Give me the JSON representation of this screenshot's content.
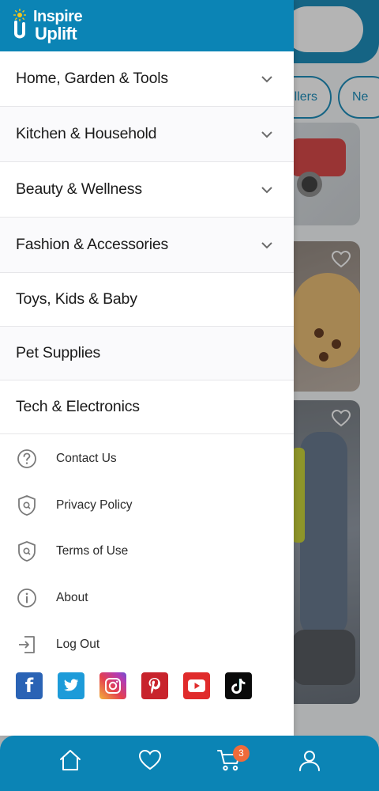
{
  "app": {
    "brand_line1": "Inspire",
    "brand_line2": "Uplift",
    "brand_color": "#0b84b5"
  },
  "background": {
    "chips": [
      "Best Sellers",
      "New"
    ],
    "chip_visible": [
      "llers",
      "Ne"
    ]
  },
  "drawer": {
    "categories": [
      {
        "label": "Home, Garden & Tools",
        "expandable": true
      },
      {
        "label": "Kitchen & Household",
        "expandable": true
      },
      {
        "label": "Beauty & Wellness",
        "expandable": true
      },
      {
        "label": "Fashion & Accessories",
        "expandable": true
      },
      {
        "label": "Toys, Kids & Baby",
        "expandable": false
      },
      {
        "label": "Pet Supplies",
        "expandable": false
      },
      {
        "label": "Tech & Electronics",
        "expandable": false
      }
    ],
    "utility": [
      {
        "label": "Contact Us",
        "icon": "question-circle-icon"
      },
      {
        "label": "Privacy Policy",
        "icon": "shield-icon"
      },
      {
        "label": "Terms of Use",
        "icon": "shield-icon"
      },
      {
        "label": "About",
        "icon": "info-circle-icon"
      },
      {
        "label": "Log Out",
        "icon": "logout-icon"
      }
    ],
    "social": [
      "facebook-icon",
      "twitter-icon",
      "instagram-icon",
      "pinterest-icon",
      "youtube-icon",
      "tiktok-icon"
    ]
  },
  "bottom_nav": {
    "items": [
      "home-icon",
      "heart-icon",
      "cart-icon",
      "user-icon"
    ],
    "cart_count": "3",
    "badge_color": "#f06b3a"
  }
}
